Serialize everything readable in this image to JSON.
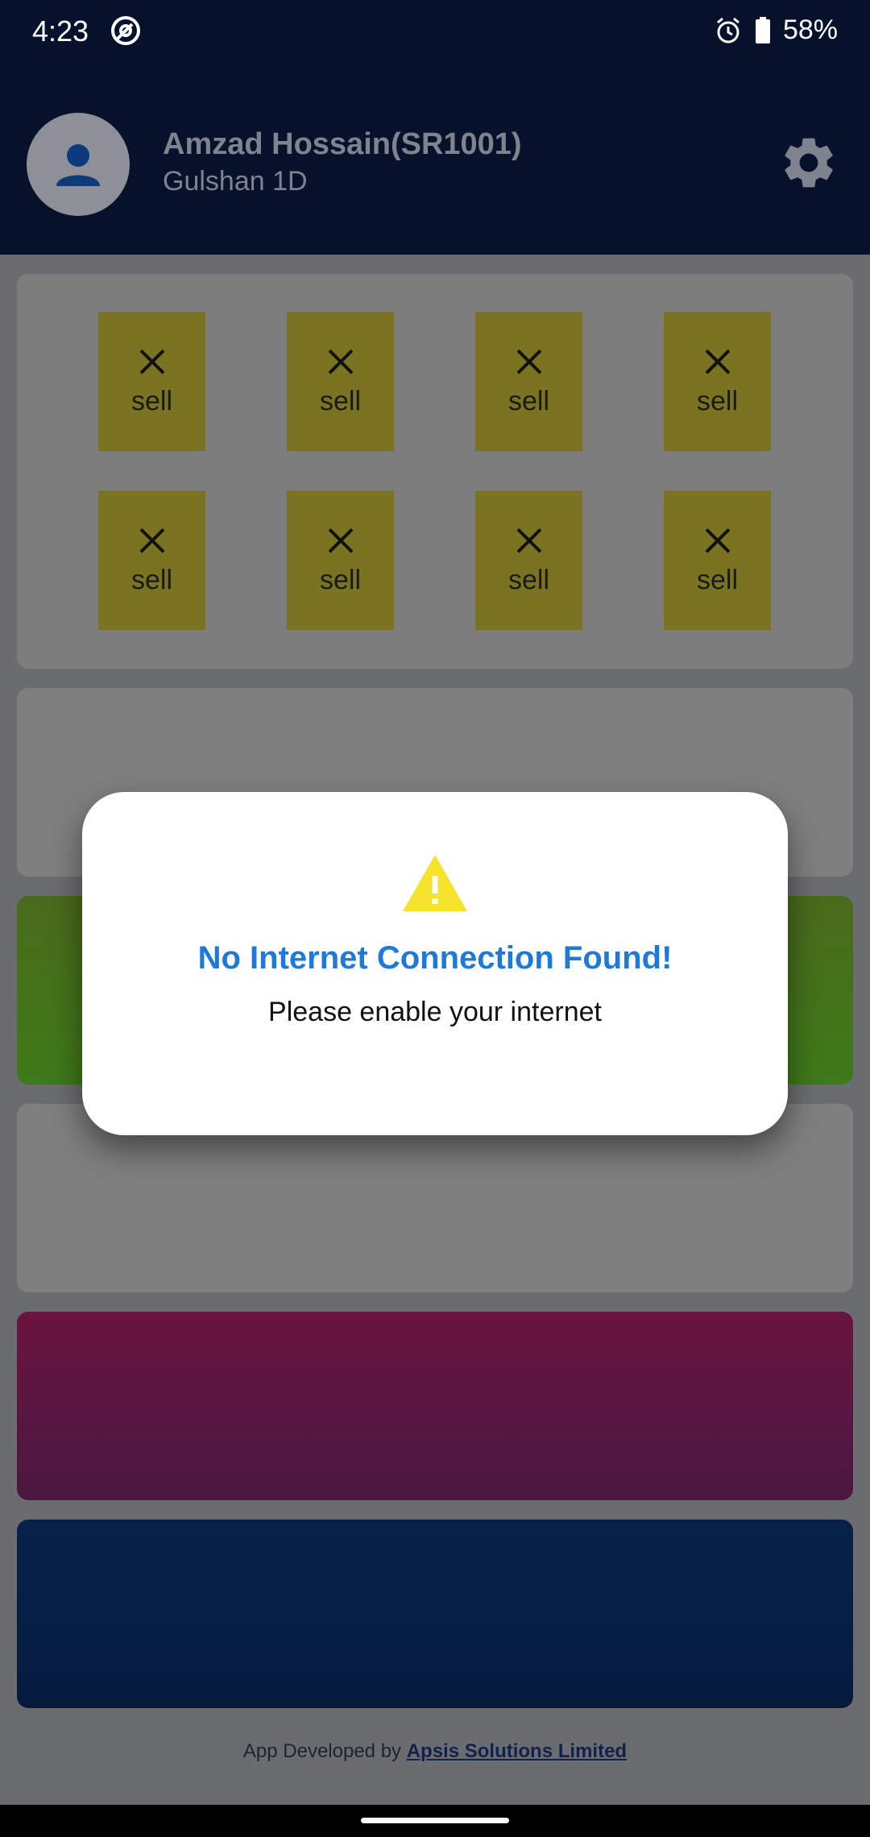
{
  "status_bar": {
    "time": "4:23",
    "battery_percent": "58%",
    "icons": [
      "at-sign-notification-icon",
      "alarm-icon",
      "battery-icon"
    ]
  },
  "header": {
    "user_name": "Amzad Hossain(SR1001)",
    "area": "Gulshan 1D",
    "icons": [
      "avatar-person-icon",
      "settings-gear-icon"
    ]
  },
  "grid": {
    "tiles": [
      {
        "label": "sell",
        "icon": "close-x-icon"
      },
      {
        "label": "sell",
        "icon": "close-x-icon"
      },
      {
        "label": "sell",
        "icon": "close-x-icon"
      },
      {
        "label": "sell",
        "icon": "close-x-icon"
      },
      {
        "label": "sell",
        "icon": "close-x-icon"
      },
      {
        "label": "sell",
        "icon": "close-x-icon"
      },
      {
        "label": "sell",
        "icon": "close-x-icon"
      },
      {
        "label": "sell",
        "icon": "close-x-icon"
      }
    ]
  },
  "dialog": {
    "title": "No Internet Connection Found!",
    "message": "Please enable your internet",
    "icon": "warning-triangle-icon"
  },
  "footer": {
    "prefix": "App Developed by ",
    "company": "Apsis Solutions Limited"
  },
  "colors": {
    "appbar": "#06112b",
    "tile": "#7a7321",
    "dialog_title": "#1e7ad6",
    "warning": "#f5e32e"
  }
}
